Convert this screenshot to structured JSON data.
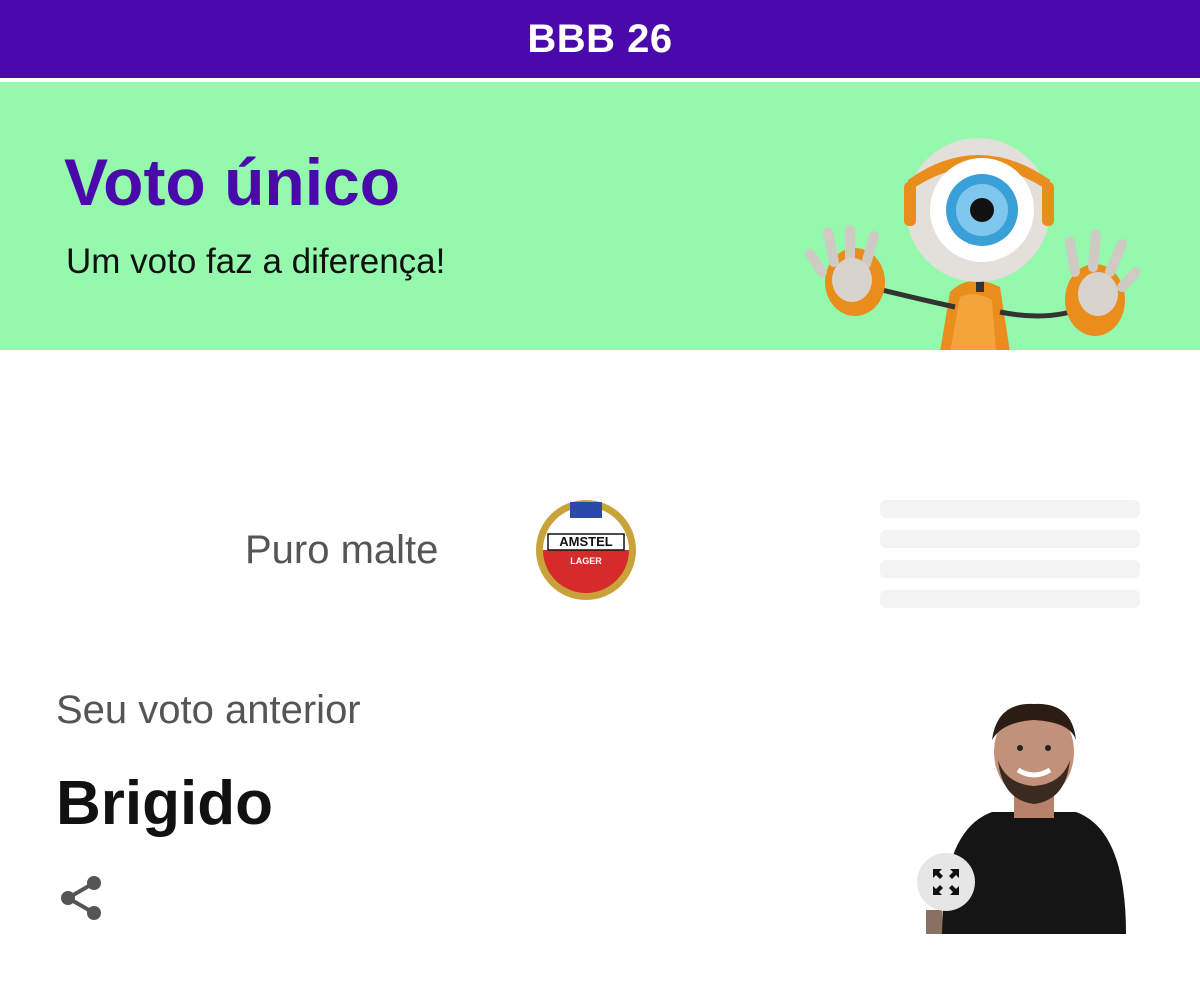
{
  "header": {
    "title": "BBB 26"
  },
  "banner": {
    "title": "Voto único",
    "subtitle": "Um voto faz a diferença!",
    "background_color": "#94f8ad",
    "title_color": "#4a0aab",
    "mascot_icon": "big-eye-mascot"
  },
  "sponsor": {
    "tagline": "Puro malte",
    "logo_text": "AMSTEL",
    "logo_subtext": "LAGER"
  },
  "previous_vote": {
    "label": "Seu voto anterior",
    "name": "Brigido",
    "share_icon": "share-icon",
    "expand_icon": "expand-icon"
  },
  "colors": {
    "brand_purple": "#4a0aab",
    "banner_green": "#94f8ad",
    "amstel_red": "#d62b2b",
    "amstel_gold": "#c9a23a"
  }
}
